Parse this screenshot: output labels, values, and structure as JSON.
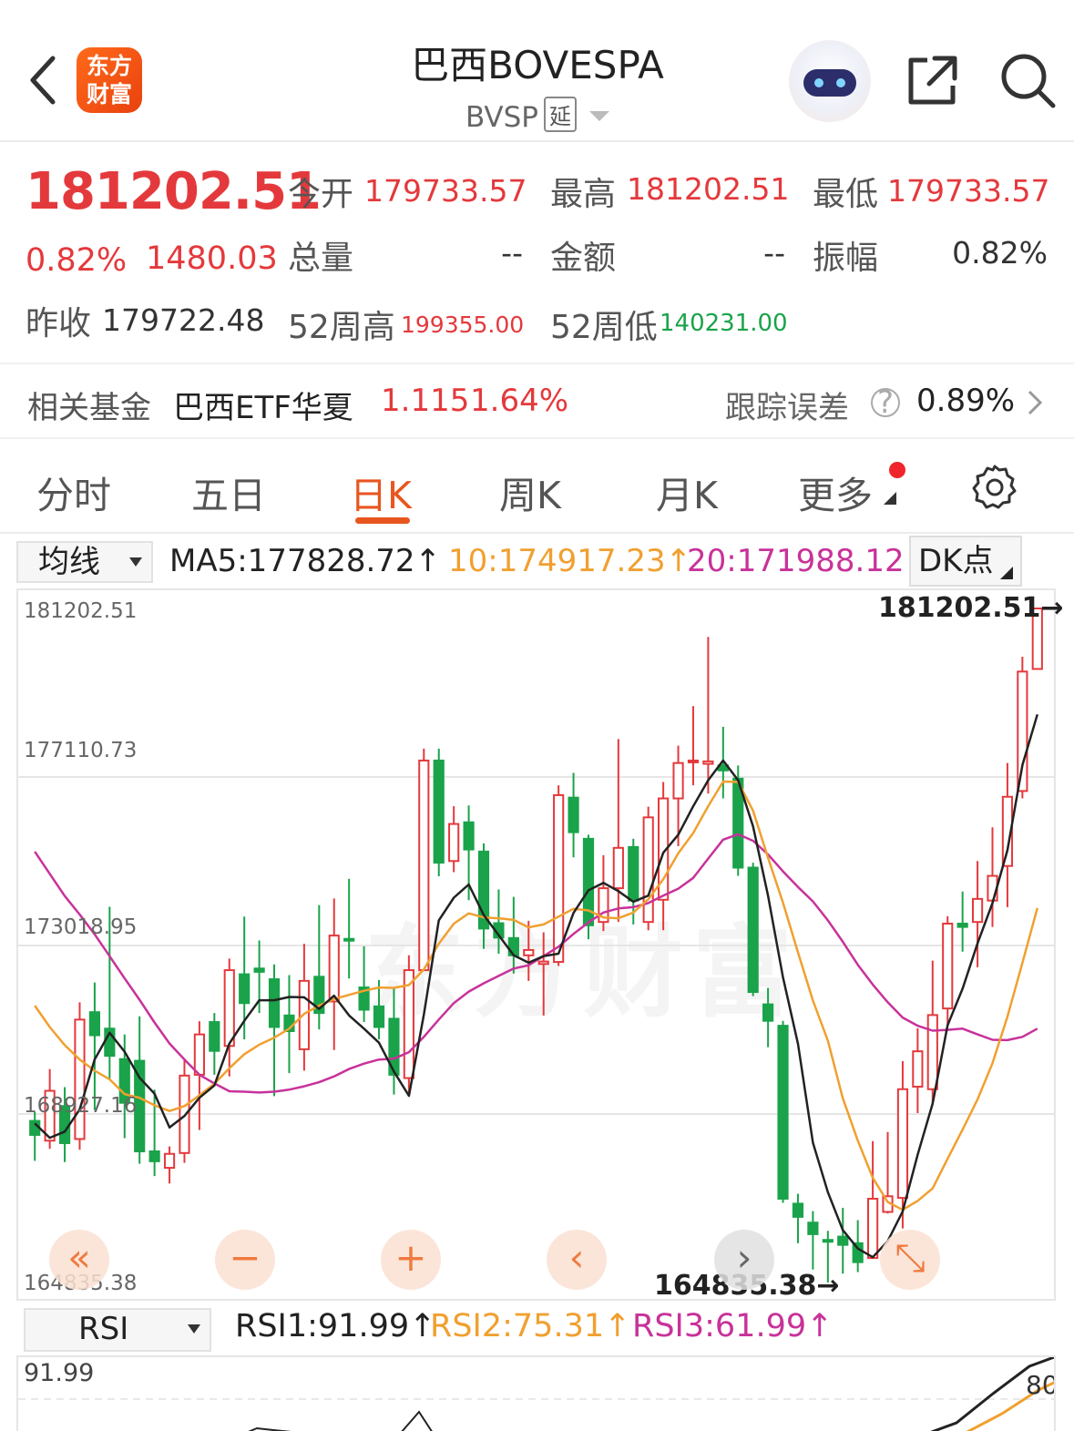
{
  "header": {
    "logo_line1": "东方",
    "logo_line2": "财富",
    "title": "巴西BOVESPA",
    "code": "BVSP",
    "delay_tag": "延"
  },
  "quote": {
    "price": "181202.51",
    "change_pct": "0.82%",
    "change": "1480.03",
    "open_label": "今开",
    "open": "179733.57",
    "high_label": "最高",
    "high": "181202.51",
    "low_label": "最低",
    "low": "179733.57",
    "volume_label": "总量",
    "volume": "--",
    "amount_label": "金额",
    "amount": "--",
    "amplitude_label": "振幅",
    "amplitude": "0.82%",
    "prev_close_label": "昨收",
    "prev_close": "179722.48",
    "high52_label": "52周高",
    "high52": "199355.00",
    "low52_label": "52周低",
    "low52": "140231.00"
  },
  "fund": {
    "label": "相关基金",
    "name": "巴西ETF华夏",
    "price": "1.115",
    "pct": "1.64%",
    "tracking_label": "跟踪误差",
    "help": "?",
    "tracking_value": "0.89%"
  },
  "tabs": [
    "分时",
    "五日",
    "日K",
    "周K",
    "月K",
    "更多"
  ],
  "ma_bar": {
    "selector": "均线",
    "ma5": "MA5:177828.72↑",
    "ma10": "10:174917.23↑",
    "ma20": "20:171988.12↑",
    "dk": "DK点"
  },
  "chart": {
    "y_labels": [
      "181202.51",
      "177110.73",
      "173018.95",
      "168927.16",
      "164835.38"
    ],
    "max_marker": "181202.51→",
    "min_marker": "164835.38→",
    "watermark": "东方财富",
    "controls": [
      "«",
      "−",
      "+",
      "‹",
      "›",
      "⤡"
    ]
  },
  "colors": {
    "up": "#e4393c",
    "down": "#1aa34a",
    "ma5": "#222222",
    "ma10": "#f0a030",
    "ma20": "#c8329a",
    "accent": "#e8561f"
  },
  "rsi": {
    "selector": "RSI",
    "rsi1": "RSI1:91.99↑",
    "rsi2": "RSI2:75.31↑",
    "rsi3": "RSI3:61.99↑",
    "top_label": "91.99",
    "level_label": "80"
  },
  "chart_data": {
    "type": "candlestick",
    "ylim": [
      164835.38,
      181202.51
    ],
    "candles": [
      {
        "o": 168760,
        "c": 168420,
        "h": 168980,
        "l": 167790
      },
      {
        "o": 168280,
        "c": 169490,
        "h": 170020,
        "l": 168080
      },
      {
        "o": 169120,
        "c": 168220,
        "h": 169580,
        "l": 167760
      },
      {
        "o": 168320,
        "c": 171220,
        "h": 171640,
        "l": 168060
      },
      {
        "o": 171400,
        "c": 170840,
        "h": 172120,
        "l": 169020
      },
      {
        "o": 171000,
        "c": 170340,
        "h": 173960,
        "l": 169780
      },
      {
        "o": 170260,
        "c": 169200,
        "h": 170860,
        "l": 168340
      },
      {
        "o": 170220,
        "c": 168020,
        "h": 171300,
        "l": 167720
      },
      {
        "o": 168020,
        "c": 167780,
        "h": 169520,
        "l": 167420
      },
      {
        "o": 167620,
        "c": 167960,
        "h": 168140,
        "l": 167240
      },
      {
        "o": 167980,
        "c": 169860,
        "h": 170280,
        "l": 167740
      },
      {
        "o": 169880,
        "c": 170860,
        "h": 171180,
        "l": 168540
      },
      {
        "o": 171160,
        "c": 170460,
        "h": 171380,
        "l": 169880
      },
      {
        "o": 170580,
        "c": 172420,
        "h": 172700,
        "l": 169840
      },
      {
        "o": 172320,
        "c": 171620,
        "h": 173720,
        "l": 170740
      },
      {
        "o": 172460,
        "c": 172380,
        "h": 173140,
        "l": 171380
      },
      {
        "o": 172200,
        "c": 171040,
        "h": 172560,
        "l": 169360
      },
      {
        "o": 171320,
        "c": 170940,
        "h": 172300,
        "l": 169920
      },
      {
        "o": 170500,
        "c": 172160,
        "h": 173060,
        "l": 169980
      },
      {
        "o": 172260,
        "c": 171380,
        "h": 174000,
        "l": 170980
      },
      {
        "o": 171660,
        "c": 173260,
        "h": 174160,
        "l": 170480
      },
      {
        "o": 173180,
        "c": 173160,
        "h": 174640,
        "l": 172220
      },
      {
        "o": 172000,
        "c": 171460,
        "h": 173000,
        "l": 171160
      },
      {
        "o": 171540,
        "c": 171040,
        "h": 172180,
        "l": 170740
      },
      {
        "o": 171240,
        "c": 169880,
        "h": 172000,
        "l": 169400
      },
      {
        "o": 169800,
        "c": 172420,
        "h": 172780,
        "l": 169400
      },
      {
        "o": 172420,
        "c": 177510,
        "h": 177800,
        "l": 172600
      },
      {
        "o": 177510,
        "c": 175030,
        "h": 177800,
        "l": 174700
      },
      {
        "o": 175070,
        "c": 175970,
        "h": 176400,
        "l": 174800
      },
      {
        "o": 176010,
        "c": 175350,
        "h": 176420,
        "l": 174120
      },
      {
        "o": 175300,
        "c": 173430,
        "h": 175500,
        "l": 172940
      },
      {
        "o": 173560,
        "c": 173210,
        "h": 174380,
        "l": 172820
      },
      {
        "o": 173200,
        "c": 172780,
        "h": 174200,
        "l": 172340
      },
      {
        "o": 172780,
        "c": 172910,
        "h": 173620,
        "l": 172160
      },
      {
        "o": 172570,
        "c": 172630,
        "h": 173340,
        "l": 171320
      },
      {
        "o": 172620,
        "c": 176670,
        "h": 176910,
        "l": 172520
      },
      {
        "o": 176610,
        "c": 175770,
        "h": 177210,
        "l": 175160
      },
      {
        "o": 175610,
        "c": 173510,
        "h": 175710,
        "l": 173170
      },
      {
        "o": 173590,
        "c": 174410,
        "h": 175210,
        "l": 173370
      },
      {
        "o": 174410,
        "c": 175390,
        "h": 178030,
        "l": 173590
      },
      {
        "o": 175410,
        "c": 174110,
        "h": 175610,
        "l": 173530
      },
      {
        "o": 173590,
        "c": 176130,
        "h": 176390,
        "l": 173390
      },
      {
        "o": 174130,
        "c": 176590,
        "h": 176990,
        "l": 173390
      },
      {
        "o": 176590,
        "c": 177450,
        "h": 177870,
        "l": 175430
      },
      {
        "o": 177490,
        "c": 177510,
        "h": 178830,
        "l": 176910
      },
      {
        "o": 177430,
        "c": 177490,
        "h": 180510,
        "l": 176710
      },
      {
        "o": 177390,
        "c": 177270,
        "h": 178330,
        "l": 176590
      },
      {
        "o": 177070,
        "c": 174910,
        "h": 177390,
        "l": 174710
      },
      {
        "o": 174910,
        "c": 171890,
        "h": 175030,
        "l": 171790
      },
      {
        "o": 171590,
        "c": 171190,
        "h": 171990,
        "l": 170550
      },
      {
        "o": 171070,
        "c": 166870,
        "h": 171190,
        "l": 166770
      },
      {
        "o": 166750,
        "c": 166430,
        "h": 166990,
        "l": 165790
      },
      {
        "o": 166290,
        "c": 166010,
        "h": 166570,
        "l": 165150
      },
      {
        "o": 165870,
        "c": 165850,
        "h": 166090,
        "l": 164835
      },
      {
        "o": 165950,
        "c": 165750,
        "h": 166650,
        "l": 165050
      },
      {
        "o": 165790,
        "c": 165330,
        "h": 166350,
        "l": 165090
      },
      {
        "o": 165430,
        "c": 166870,
        "h": 168270,
        "l": 165430
      },
      {
        "o": 166550,
        "c": 166930,
        "h": 168490,
        "l": 166510
      },
      {
        "o": 166890,
        "c": 169530,
        "h": 170210,
        "l": 166150
      },
      {
        "o": 169590,
        "c": 170450,
        "h": 171010,
        "l": 168950
      },
      {
        "o": 169530,
        "c": 171330,
        "h": 172650,
        "l": 169170
      },
      {
        "o": 171490,
        "c": 173550,
        "h": 173730,
        "l": 171090
      },
      {
        "o": 173550,
        "c": 173470,
        "h": 174330,
        "l": 172870
      },
      {
        "o": 173590,
        "c": 174150,
        "h": 175070,
        "l": 172490
      },
      {
        "o": 174110,
        "c": 174710,
        "h": 175890,
        "l": 173470
      },
      {
        "o": 174950,
        "c": 176630,
        "h": 177450,
        "l": 173950
      },
      {
        "o": 176770,
        "c": 179670,
        "h": 180030,
        "l": 176590
      },
      {
        "o": 179733.57,
        "c": 181202.51,
        "h": 181202.51,
        "l": 179733.57
      }
    ],
    "ma5": [
      168700,
      168350,
      168500,
      169040,
      170250,
      170900,
      170440,
      169810,
      169420,
      168600,
      168880,
      169320,
      169620,
      170640,
      171190,
      171690,
      171690,
      171770,
      171760,
      171480,
      171800,
      171320,
      171000,
      170660,
      169960,
      169370,
      171340,
      173630,
      174180,
      174500,
      173760,
      173270,
      172780,
      172600,
      172760,
      172820,
      173810,
      174360,
      174540,
      174340,
      174080,
      174230,
      175270,
      175710,
      176400,
      177030,
      177510,
      177030,
      175910,
      174230,
      172250,
      170630,
      168230,
      167030,
      166110,
      165660,
      165450,
      165840,
      166560,
      167940,
      169180,
      171080,
      171970,
      173070,
      174050,
      175330,
      177400,
      178630
    ],
    "ma10": [
      171560,
      171040,
      170600,
      170250,
      169980,
      169770,
      169410,
      169320,
      169140,
      169000,
      169120,
      169380,
      169660,
      170040,
      170380,
      170610,
      170780,
      171000,
      171360,
      171560,
      171720,
      171820,
      171920,
      172000,
      171990,
      172060,
      172440,
      173060,
      173550,
      173800,
      173700,
      173680,
      173640,
      173460,
      173530,
      173720,
      173910,
      173870,
      173700,
      173680,
      173820,
      174140,
      174630,
      175260,
      175750,
      176400,
      177000,
      176990,
      176290,
      175150,
      174060,
      172850,
      171680,
      170710,
      169310,
      168280,
      167380,
      166790,
      166600,
      166820,
      167120,
      167840,
      168550,
      169280,
      170160,
      171290,
      172600,
      173930
    ],
    "ma20": [
      175300,
      174760,
      174220,
      173770,
      173290,
      172760,
      172220,
      171700,
      171150,
      170640,
      170250,
      169880,
      169670,
      169480,
      169470,
      169450,
      169470,
      169520,
      169600,
      169700,
      169840,
      170020,
      170150,
      170250,
      170270,
      170430,
      170800,
      171220,
      171620,
      171900,
      172100,
      172280,
      172460,
      172540,
      172760,
      172990,
      173300,
      173580,
      173820,
      173920,
      173950,
      174050,
      174230,
      174400,
      174660,
      175130,
      175590,
      175720,
      175560,
      175230,
      174820,
      174440,
      174090,
      173630,
      173110,
      172550,
      172070,
      171640,
      171270,
      171070,
      170950,
      170970,
      171000,
      170860,
      170730,
      170720,
      170800,
      171000
    ]
  }
}
